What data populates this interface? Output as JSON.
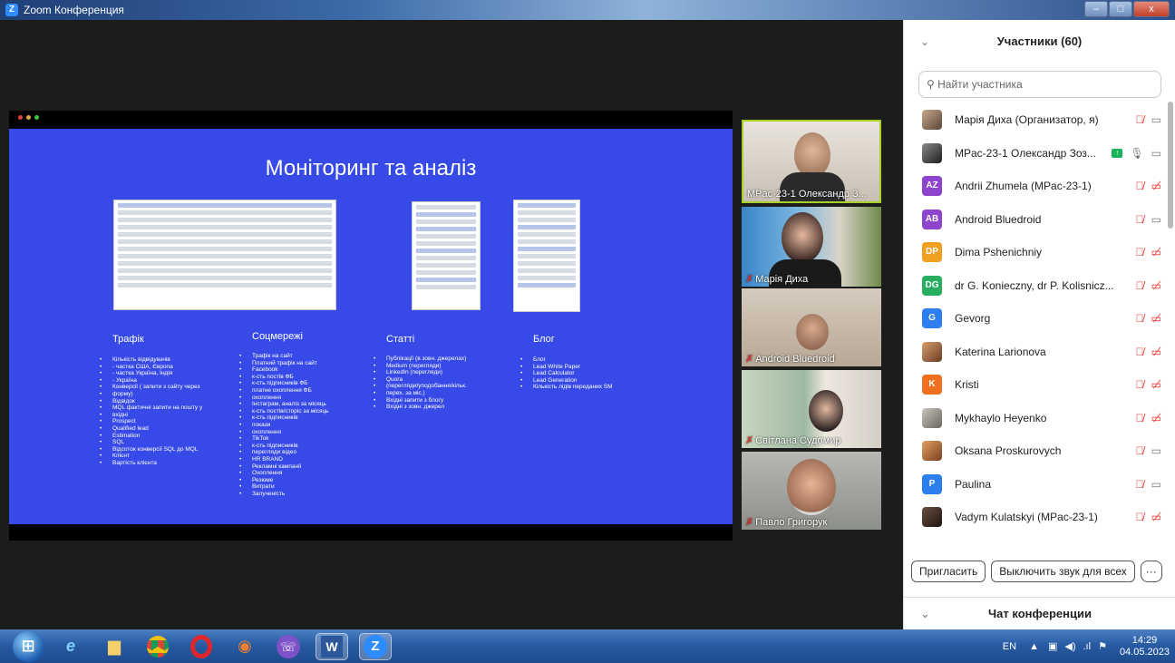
{
  "window": {
    "title": "Zoom Конференция",
    "minimize": "–",
    "maximize": "□",
    "close": "x"
  },
  "slide": {
    "title": "Моніторинг та аналіз",
    "columns": [
      {
        "heading": "Трафік",
        "items": [
          "Кількість відвідувачів",
          "- частка США, Європа",
          "- частка Україна, Індія",
          "- Україна",
          "Конверсії ( запити з сайту через",
          "форму)",
          "Відвідок",
          "MQL фактичні запити на пошту у",
          "вхідні",
          "Prospect",
          "Qualified lead",
          "Estimation",
          "SQL",
          "Відсоток конверсії SQL до MQL",
          "Клієнт",
          "Вартість клієнта"
        ]
      },
      {
        "heading": "Соцмережі",
        "items": [
          "Трафік на сайт",
          "Платний трафік на сайт",
          "Facebook",
          "к-сть постів ФБ",
          "к-сть підписників ФБ",
          "платне охоплення ФБ",
          "охоплення",
          "Інстаграм, аналіз за місяць",
          "к-сть постів/сторіс за місяць",
          "к-сть підписників",
          "покази",
          "охоплення",
          "TikTok",
          "к-сть підписників",
          "перегляди відео",
          "HR BRAND",
          "Рекламні кампанії",
          "Охоплення",
          "Резюме",
          "Витрати",
          "Залученість"
        ]
      },
      {
        "heading": "Статті",
        "items": [
          "Публікації (в зовн. джерелах)",
          "Medium (перегляди)",
          "LinkedIn (перегляди)",
          "Quora",
          "(перегляди/уподобання/кільк.",
          "перех. за міс.)",
          "Вхідні запити з блогу",
          "Вхідні з зовн. джерел"
        ]
      },
      {
        "heading": "Блог",
        "items": [
          "Блог",
          "Lead White Paper",
          "Lead Calculator",
          "Lead Generation",
          "Кількість лідів переданих SM"
        ]
      }
    ]
  },
  "tiles": [
    {
      "name": "MPac-23-1 Олександр З...",
      "muted": false,
      "active": true
    },
    {
      "name": "Марія Диха",
      "muted": true,
      "active": false
    },
    {
      "name": "Android Bluedroid",
      "muted": true,
      "active": false
    },
    {
      "name": "Світлана Судомир",
      "muted": true,
      "active": false
    },
    {
      "name": "Павло Григорук",
      "muted": true,
      "active": false
    }
  ],
  "panel": {
    "title": "Участники (60)",
    "search_placeholder": "Найти участника",
    "participants": [
      {
        "name": "Марія Диха (Организатор, я)",
        "avatar": "",
        "color": "",
        "cam": "on"
      },
      {
        "name": "MPac-23-1 Олександр Зоз...",
        "avatar": "",
        "color": "",
        "cam": "on",
        "sharing": true
      },
      {
        "name": "Andrii Zhumela (MPac-23-1)",
        "avatar": "AZ",
        "color": "#8e44cc",
        "cam": "off"
      },
      {
        "name": "Android Bluedroid",
        "avatar": "AB",
        "color": "#8e44cc",
        "cam": "on"
      },
      {
        "name": "Dima Pshenichniy",
        "avatar": "DP",
        "color": "#f0a020",
        "cam": "off"
      },
      {
        "name": "dr G. Konieczny, dr P. Kolisnicz...",
        "avatar": "DG",
        "color": "#27ae60",
        "cam": "off"
      },
      {
        "name": "Gevorg",
        "avatar": "G",
        "color": "#2d7ff0",
        "cam": "off"
      },
      {
        "name": "Katerina Larionova",
        "avatar": "",
        "color": "",
        "cam": "off"
      },
      {
        "name": "Kristi",
        "avatar": "K",
        "color": "#f07020",
        "cam": "off"
      },
      {
        "name": "Mykhaylo Heyenko",
        "avatar": "",
        "color": "",
        "cam": "off"
      },
      {
        "name": "Oksana Proskurovych",
        "avatar": "",
        "color": "",
        "cam": "on"
      },
      {
        "name": "Paulina",
        "avatar": "P",
        "color": "#2d7ff0",
        "cam": "on"
      },
      {
        "name": "Vadym Kulatskyi (MPac-23-1)",
        "avatar": "",
        "color": "",
        "cam": "off"
      }
    ],
    "invite": "Пригласить",
    "mute_all": "Выключить звук для всех",
    "more": "···",
    "chat_title": "Чат конференции"
  },
  "taskbar": {
    "lang": "EN",
    "time": "14:29",
    "date": "04.05.2023"
  }
}
